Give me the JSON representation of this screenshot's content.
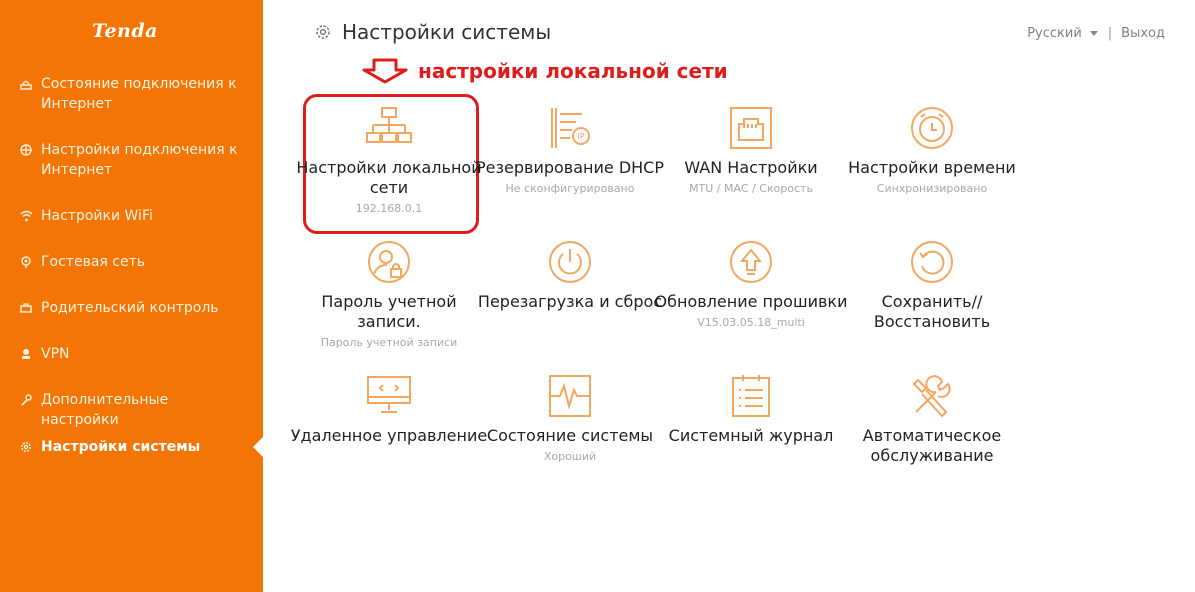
{
  "brand": {
    "logo": "Tenda",
    "accent": "#f27506"
  },
  "sidebar": {
    "items": [
      {
        "label": "Состояние подключения к Интернет",
        "icon": "globe-icon"
      },
      {
        "label": "Настройки подключения к Интернет",
        "icon": "network-icon"
      },
      {
        "label": "Настройки WiFi",
        "icon": "wifi-icon"
      },
      {
        "label": "Гостевая сеть",
        "icon": "guest-icon"
      },
      {
        "label": "Родительский контроль",
        "icon": "parental-icon"
      },
      {
        "label": "VPN",
        "icon": "vpn-icon"
      },
      {
        "label": "Дополнительные настройки",
        "icon": "wrench-icon"
      },
      {
        "label": "Настройки системы",
        "icon": "gear-icon",
        "active": true
      }
    ]
  },
  "header": {
    "title": "Настройки системы",
    "language": "Русский",
    "separator": "|",
    "logout": "Выход"
  },
  "annotation": {
    "text": "настройки локальной сети",
    "color": "#dd1c1c"
  },
  "tiles": [
    {
      "title": "Настройки локальной сети",
      "subtitle": "192.168.0.1",
      "icon": "lan-topology-icon"
    },
    {
      "title": "Резервирование DHCP",
      "subtitle": "Не сконфигурировано",
      "icon": "dhcp-reservation-icon"
    },
    {
      "title": "WAN Настройки",
      "subtitle": "MTU / MAC / Скорость",
      "icon": "ethernet-port-icon"
    },
    {
      "title": "Настройки времени",
      "subtitle": "Синхронизировано",
      "icon": "alarm-clock-icon"
    },
    {
      "title": "Пароль учетной записи.",
      "subtitle": "Пароль учетной записи",
      "icon": "user-lock-icon"
    },
    {
      "title": "Перезагрузка и сброс",
      "subtitle": "",
      "icon": "power-icon"
    },
    {
      "title": "Обновление прошивки",
      "subtitle": "V15.03.05.18_multi",
      "icon": "upgrade-arrow-icon"
    },
    {
      "title": "Сохранить// Восстановить",
      "subtitle": "",
      "icon": "restore-icon"
    },
    {
      "title": "Удаленное управление",
      "subtitle": "",
      "icon": "remote-monitor-icon"
    },
    {
      "title": "Состояние системы",
      "subtitle": "Хороший",
      "icon": "pulse-icon"
    },
    {
      "title": "Системный журнал",
      "subtitle": "",
      "icon": "log-list-icon"
    },
    {
      "title": "Автоматическое обслуживание",
      "subtitle": "",
      "icon": "tools-icon"
    }
  ]
}
